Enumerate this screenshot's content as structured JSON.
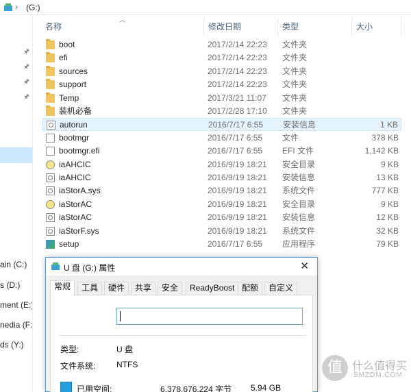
{
  "address": {
    "path": "(G:)"
  },
  "nav": {
    "drives": [
      "ain (C:)",
      "s (D:)",
      "ment (E:)",
      "nedia (F:)",
      "ds (Y:)"
    ]
  },
  "columns": {
    "name": "名称",
    "date": "修改日期",
    "type": "类型",
    "size": "大小"
  },
  "files": [
    {
      "name": "boot",
      "date": "2017/2/14 22:23",
      "type": "文件夹",
      "size": "",
      "icon": "folder-icon"
    },
    {
      "name": "efi",
      "date": "2017/2/14 22:23",
      "type": "文件夹",
      "size": "",
      "icon": "folder-icon"
    },
    {
      "name": "sources",
      "date": "2017/2/14 22:23",
      "type": "文件夹",
      "size": "",
      "icon": "folder-icon"
    },
    {
      "name": "support",
      "date": "2017/2/14 22:23",
      "type": "文件夹",
      "size": "",
      "icon": "folder-icon"
    },
    {
      "name": "Temp",
      "date": "2017/3/21 11:07",
      "type": "文件夹",
      "size": "",
      "icon": "folder-icon"
    },
    {
      "name": "装机必备",
      "date": "2017/2/28 17:10",
      "type": "文件夹",
      "size": "",
      "icon": "folder-icon"
    },
    {
      "name": "autorun",
      "date": "2016/7/17 6:55",
      "type": "安装信息",
      "size": "1 KB",
      "icon": "settings-file-icon"
    },
    {
      "name": "bootmgr",
      "date": "2016/7/17 6:55",
      "type": "文件",
      "size": "378 KB",
      "icon": "file-icon"
    },
    {
      "name": "bootmgr.efi",
      "date": "2016/7/17 6:55",
      "type": "EFI 文件",
      "size": "1,142 KB",
      "icon": "file-icon"
    },
    {
      "name": "iaAHCIC",
      "date": "2016/9/19 18:21",
      "type": "安全目录",
      "size": "9 KB",
      "icon": "security-catalog-icon"
    },
    {
      "name": "iaAHCIC",
      "date": "2016/9/19 18:21",
      "type": "安装信息",
      "size": "13 KB",
      "icon": "settings-file-icon"
    },
    {
      "name": "iaStorA.sys",
      "date": "2016/9/19 18:21",
      "type": "系统文件",
      "size": "777 KB",
      "icon": "settings-file-icon"
    },
    {
      "name": "iaStorAC",
      "date": "2016/9/19 18:21",
      "type": "安全目录",
      "size": "9 KB",
      "icon": "security-catalog-icon"
    },
    {
      "name": "iaStorAC",
      "date": "2016/9/19 18:21",
      "type": "安装信息",
      "size": "12 KB",
      "icon": "settings-file-icon"
    },
    {
      "name": "iaStorF.sys",
      "date": "2016/9/19 18:21",
      "type": "系统文件",
      "size": "32 KB",
      "icon": "settings-file-icon"
    },
    {
      "name": "setup",
      "date": "2016/7/17 6:55",
      "type": "应用程序",
      "size": "79 KB",
      "icon": "setup-app-icon"
    }
  ],
  "selected_index": 6,
  "dialog": {
    "title": "U 盘 (G:) 属性",
    "tabs": [
      "常规",
      "工具",
      "硬件",
      "共享",
      "安全",
      "ReadyBoost",
      "配额",
      "自定义"
    ],
    "name_value": "",
    "type_label": "类型:",
    "type_value": "U 盘",
    "fs_label": "文件系统:",
    "fs_value": "NTFS",
    "used_label": "已用空间:",
    "used_bytes": "6,378,676,224 字节",
    "used_size": "5.94 GB"
  },
  "watermark": {
    "logo": "值",
    "line1": "什么值得买",
    "line2": "SMZDM.COM"
  },
  "colors": {
    "selection": "#e5f3ff",
    "accent": "#26a0da",
    "folder": "#f1c75c"
  }
}
